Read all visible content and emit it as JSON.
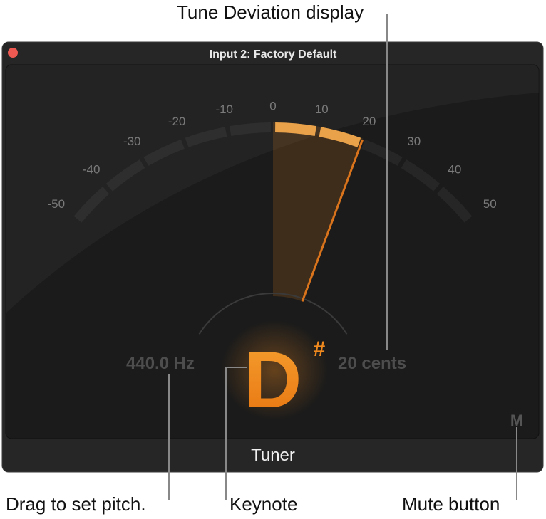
{
  "annotations": {
    "tune_deviation": "Tune Deviation display",
    "drag_pitch": "Drag to set pitch.",
    "keynote": "Keynote",
    "mute": "Mute button"
  },
  "window": {
    "title": "Input 2: Factory Default",
    "footer": "Tuner"
  },
  "tuner": {
    "scale_labels": [
      "-50",
      "-40",
      "-30",
      "-20",
      "-10",
      "0",
      "10",
      "20",
      "30",
      "40",
      "50"
    ],
    "scale_values": [
      -50,
      -40,
      -30,
      -20,
      -10,
      0,
      10,
      20,
      30,
      40,
      50
    ],
    "deviation_cents": 20,
    "reference_pitch": "440.0 Hz",
    "deviation_text": "20 cents",
    "note": "D",
    "accidental": "#",
    "mute_label": "M"
  },
  "colors": {
    "accent": "#f08a1e",
    "close": "#ee5a52",
    "panel": "#1b1b1b"
  }
}
